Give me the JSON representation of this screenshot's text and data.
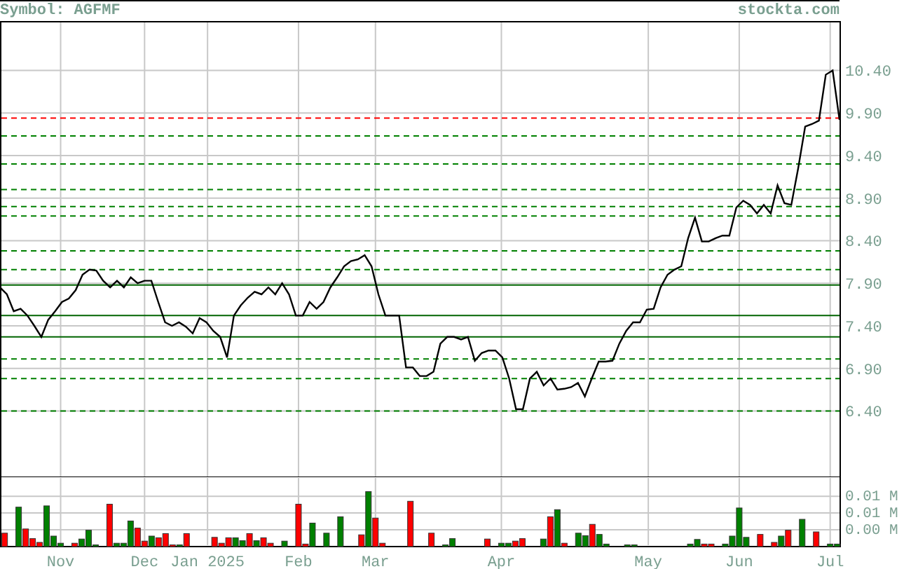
{
  "header": {
    "symbol": "Symbol: AGFMF",
    "site": "stockta.com"
  },
  "price_chart": {
    "chart_data": {
      "type": "line",
      "grid": true,
      "ylim": [
        5.63,
        10.98
      ],
      "yticks": [
        {
          "value": 10.4,
          "label": "10.40"
        },
        {
          "value": 9.9,
          "label": "9.90"
        },
        {
          "value": 9.4,
          "label": "9.40"
        },
        {
          "value": 8.9,
          "label": "8.90"
        },
        {
          "value": 8.4,
          "label": "8.40"
        },
        {
          "value": 7.9,
          "label": "7.90"
        },
        {
          "value": 7.4,
          "label": "7.40"
        },
        {
          "value": 6.9,
          "label": "6.90"
        },
        {
          "value": 6.4,
          "label": "6.40"
        }
      ],
      "series": [
        {
          "color": "#000000",
          "values": [
            7.85,
            7.77,
            7.57,
            7.6,
            7.52,
            7.4,
            7.27,
            7.47,
            7.57,
            7.68,
            7.72,
            7.82,
            8.0,
            8.06,
            8.05,
            7.93,
            7.85,
            7.93,
            7.85,
            7.97,
            7.9,
            7.93,
            7.93,
            7.68,
            7.44,
            7.4,
            7.44,
            7.39,
            7.31,
            7.49,
            7.44,
            7.34,
            7.27,
            7.03,
            7.52,
            7.64,
            7.73,
            7.8,
            7.77,
            7.85,
            7.77,
            7.9,
            7.77,
            7.52,
            7.52,
            7.68,
            7.6,
            7.68,
            7.85,
            7.97,
            8.1,
            8.16,
            8.18,
            8.23,
            8.1,
            7.77,
            7.52,
            7.52,
            7.52,
            6.91,
            6.91,
            6.81,
            6.81,
            6.86,
            7.19,
            7.27,
            7.27,
            7.24,
            7.27,
            6.99,
            7.08,
            7.11,
            7.11,
            7.03,
            6.78,
            6.42,
            6.42,
            6.78,
            6.86,
            6.7,
            6.78,
            6.65,
            6.66,
            6.68,
            6.73,
            6.57,
            6.78,
            6.98,
            6.98,
            6.99,
            7.19,
            7.34,
            7.44,
            7.44,
            7.59,
            7.6,
            7.85,
            8.0,
            8.06,
            8.1,
            8.43,
            8.67,
            8.39,
            8.39,
            8.43,
            8.46,
            8.46,
            8.79,
            8.87,
            8.82,
            8.72,
            8.82,
            8.72,
            9.05,
            8.84,
            8.82,
            9.25,
            9.74,
            9.77,
            9.81,
            10.35,
            10.4,
            9.82
          ]
        }
      ],
      "ref_lines": [
        {
          "axis": "y",
          "value": 9.84,
          "color": "#ff0000"
        },
        {
          "axis": "y",
          "value": 9.63,
          "color": "#008000"
        },
        {
          "axis": "y",
          "value": 9.3,
          "color": "#008000"
        },
        {
          "axis": "y",
          "value": 9.0,
          "color": "#008000"
        },
        {
          "axis": "y",
          "value": 8.8,
          "color": "#008000"
        },
        {
          "axis": "y",
          "value": 8.69,
          "color": "#008000"
        },
        {
          "axis": "y",
          "value": 8.28,
          "color": "#008000"
        },
        {
          "axis": "y",
          "value": 8.06,
          "color": "#008000"
        },
        {
          "axis": "y",
          "value": 7.88,
          "color": "#006400"
        },
        {
          "axis": "y",
          "value": 7.52,
          "color": "#006400"
        },
        {
          "axis": "y",
          "value": 7.27,
          "color": "#006400"
        },
        {
          "axis": "y",
          "value": 7.01,
          "color": "#008000"
        },
        {
          "axis": "y",
          "value": 6.78,
          "color": "#008000"
        },
        {
          "axis": "y",
          "value": 6.4,
          "color": "#008000"
        }
      ]
    }
  },
  "volume_chart": {
    "chart_data": {
      "type": "bar",
      "grid": true,
      "ylim": [
        0,
        0.0167
      ],
      "yticks": [
        {
          "value": 0.012,
          "label": "0.01 M"
        },
        {
          "value": 0.008,
          "label": "0.01 M"
        },
        {
          "value": 0.004,
          "label": "0.00 M"
        }
      ],
      "categories": [
        null,
        null,
        null,
        null,
        null,
        null,
        null,
        null,
        "Nov",
        null,
        null,
        null,
        null,
        null,
        null,
        null,
        null,
        null,
        null,
        null,
        "Dec",
        null,
        null,
        null,
        null,
        null,
        null,
        null,
        null,
        "Jan 2025",
        null,
        null,
        null,
        null,
        null,
        null,
        null,
        null,
        null,
        null,
        null,
        null,
        "Feb",
        null,
        null,
        null,
        null,
        null,
        null,
        null,
        null,
        null,
        null,
        "Mar",
        null,
        null,
        null,
        null,
        null,
        null,
        null,
        null,
        null,
        null,
        null,
        null,
        null,
        null,
        null,
        null,
        null,
        "Apr",
        null,
        null,
        null,
        null,
        null,
        null,
        null,
        null,
        null,
        null,
        null,
        null,
        null,
        null,
        null,
        null,
        null,
        null,
        null,
        null,
        "May",
        null,
        null,
        null,
        null,
        null,
        null,
        null,
        null,
        null,
        null,
        null,
        null,
        "Jun",
        null,
        null,
        null,
        null,
        null,
        null,
        null,
        null,
        null,
        null,
        null,
        null,
        "Jul",
        null
      ],
      "series": [
        {
          "color": "#008000",
          "values": [
            null,
            null,
            0.0094,
            null,
            null,
            null,
            0.0097,
            0.0025,
            0.0008,
            null,
            null,
            0.0018,
            0.0039,
            0.0004,
            null,
            null,
            0.0008,
            0.0008,
            0.0061,
            null,
            null,
            0.0025,
            null,
            null,
            null,
            0.0004,
            null,
            null,
            null,
            null,
            null,
            null,
            null,
            0.0021,
            0.0014,
            null,
            0.0014,
            null,
            null,
            null,
            0.0013,
            null,
            null,
            null,
            0.0056,
            null,
            0.0032,
            null,
            0.0071,
            null,
            null,
            null,
            0.0131,
            null,
            null,
            null,
            null,
            null,
            null,
            null,
            null,
            null,
            null,
            0.0004,
            0.0019,
            null,
            null,
            null,
            null,
            null,
            null,
            0.0008,
            0.0008,
            null,
            null,
            null,
            null,
            0.0018,
            null,
            0.0088,
            null,
            null,
            0.0032,
            0.0026,
            null,
            0.0029,
            0.0006,
            null,
            null,
            0.0004,
            0.0004,
            null,
            null,
            null,
            null,
            null,
            null,
            null,
            0.0006,
            0.0017,
            null,
            null,
            null,
            0.0006,
            0.0025,
            0.0092,
            0.0022,
            null,
            null,
            null,
            null,
            0.0025,
            null,
            null,
            0.0065,
            null,
            null,
            null,
            0.0006,
            0.0006
          ]
        },
        {
          "color": "#ff0000",
          "values": [
            0.0032,
            null,
            null,
            0.0042,
            0.0019,
            0.001,
            null,
            null,
            null,
            null,
            0.0008,
            null,
            null,
            null,
            null,
            0.0101,
            null,
            null,
            null,
            0.0044,
            0.0013,
            null,
            0.0021,
            0.0031,
            0.0004,
            null,
            0.0031,
            null,
            null,
            null,
            0.0022,
            0.0008,
            0.0021,
            null,
            null,
            0.0031,
            null,
            0.0021,
            0.0008,
            null,
            null,
            null,
            0.0101,
            0.0006,
            null,
            null,
            null,
            null,
            null,
            null,
            null,
            0.0028,
            null,
            0.0068,
            0.0008,
            null,
            null,
            null,
            0.0108,
            null,
            null,
            0.0032,
            null,
            null,
            null,
            null,
            null,
            null,
            null,
            0.0018,
            null,
            null,
            null,
            0.0013,
            0.0019,
            null,
            null,
            null,
            0.0071,
            null,
            0.0008,
            null,
            null,
            null,
            0.0053,
            null,
            null,
            null,
            null,
            null,
            null,
            null,
            null,
            null,
            null,
            null,
            null,
            null,
            null,
            null,
            0.0006,
            0.0006,
            null,
            null,
            null,
            null,
            null,
            null,
            0.0029,
            null,
            0.001,
            null,
            0.0039,
            null,
            null,
            null,
            0.0035,
            null,
            null,
            null
          ]
        }
      ]
    }
  }
}
